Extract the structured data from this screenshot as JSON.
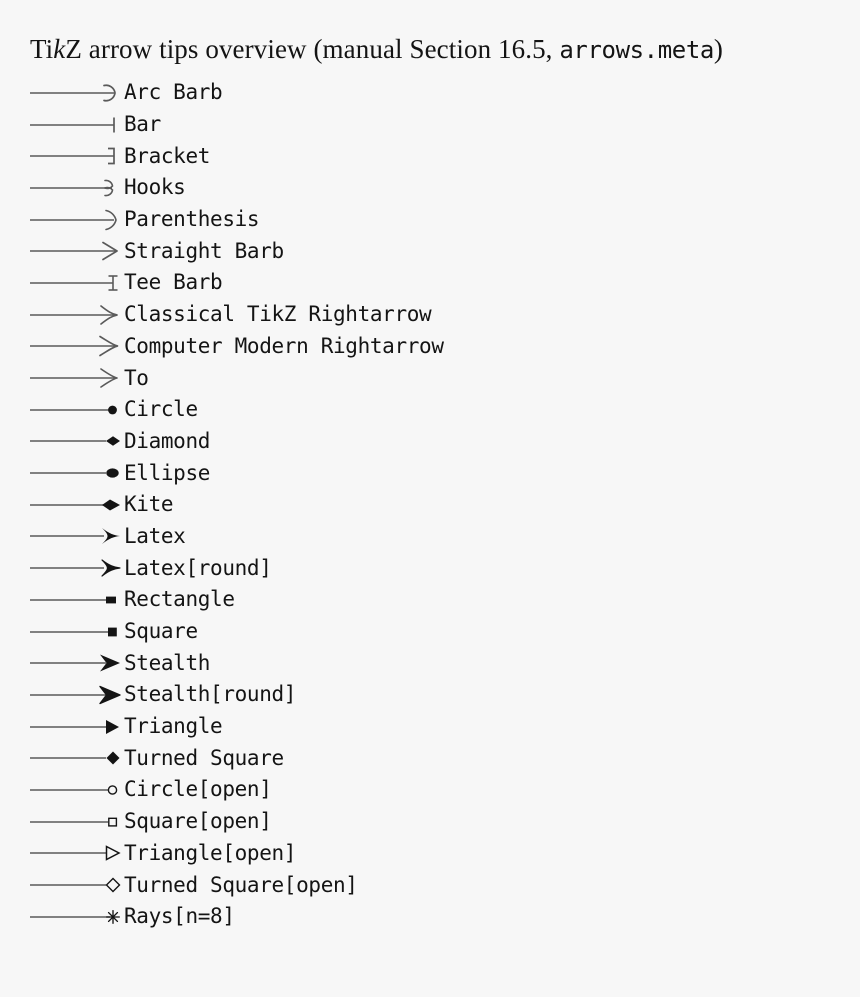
{
  "page": {
    "background_color": "#f7f7f7",
    "text_color": "#141414",
    "rule_color": "#5a5a5a"
  },
  "title": {
    "prefix": "Ti",
    "slant_k": "k",
    "middle": "Z arrow tips overview (manual Section 16.5, ",
    "mono": "arrows.meta",
    "suffix": ")",
    "full_text": "TikZ arrow tips overview (manual Section 16.5, arrows.meta)"
  },
  "rows": [
    {
      "label": "Arc Barb",
      "tip": "arc-barb-tip"
    },
    {
      "label": "Bar",
      "tip": "bar-tip"
    },
    {
      "label": "Bracket",
      "tip": "bracket-tip"
    },
    {
      "label": "Hooks",
      "tip": "hooks-tip"
    },
    {
      "label": "Parenthesis",
      "tip": "parenthesis-tip"
    },
    {
      "label": "Straight Barb",
      "tip": "straight-barb-tip"
    },
    {
      "label": "Tee Barb",
      "tip": "tee-barb-tip"
    },
    {
      "label": "Classical TikZ Rightarrow",
      "tip": "classical-tikz-rightarrow-tip"
    },
    {
      "label": "Computer Modern Rightarrow",
      "tip": "computer-modern-rightarrow-tip"
    },
    {
      "label": "To",
      "tip": "to-tip"
    },
    {
      "label": "Circle",
      "tip": "circle-tip"
    },
    {
      "label": "Diamond",
      "tip": "diamond-tip"
    },
    {
      "label": "Ellipse",
      "tip": "ellipse-tip"
    },
    {
      "label": "Kite",
      "tip": "kite-tip"
    },
    {
      "label": "Latex",
      "tip": "latex-tip"
    },
    {
      "label": "Latex[round]",
      "tip": "latex-round-tip"
    },
    {
      "label": "Rectangle",
      "tip": "rectangle-tip"
    },
    {
      "label": "Square",
      "tip": "square-tip"
    },
    {
      "label": "Stealth",
      "tip": "stealth-tip"
    },
    {
      "label": "Stealth[round]",
      "tip": "stealth-round-tip"
    },
    {
      "label": "Triangle",
      "tip": "triangle-tip"
    },
    {
      "label": "Turned Square",
      "tip": "turned-square-tip"
    },
    {
      "label": "Circle[open]",
      "tip": "circle-open-tip"
    },
    {
      "label": "Square[open]",
      "tip": "square-open-tip"
    },
    {
      "label": "Triangle[open]",
      "tip": "triangle-open-tip"
    },
    {
      "label": "Turned Square[open]",
      "tip": "turned-square-open-tip"
    },
    {
      "label": "Rays[n=8]",
      "tip": "rays-tip"
    }
  ]
}
